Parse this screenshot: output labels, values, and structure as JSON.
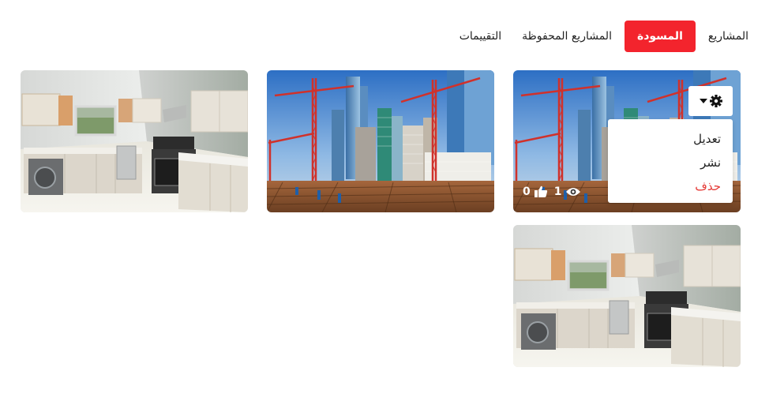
{
  "tabs": [
    {
      "label": "المشاريع",
      "active": false
    },
    {
      "label": "المسودة",
      "active": true
    },
    {
      "label": "المشاريع المحفوظة",
      "active": false
    },
    {
      "label": "التقييمات",
      "active": false
    }
  ],
  "card1": {
    "views": "1",
    "likes": "0",
    "menu": {
      "edit": "تعديل",
      "publish": "نشر",
      "delete": "حذف"
    }
  },
  "icons": {
    "settings": "gear-icon",
    "dropdown": "caret-down-icon",
    "views": "eye-icon",
    "likes": "thumbs-up-icon"
  },
  "colors": {
    "accent": "#f3242d",
    "danger": "#e53935"
  }
}
